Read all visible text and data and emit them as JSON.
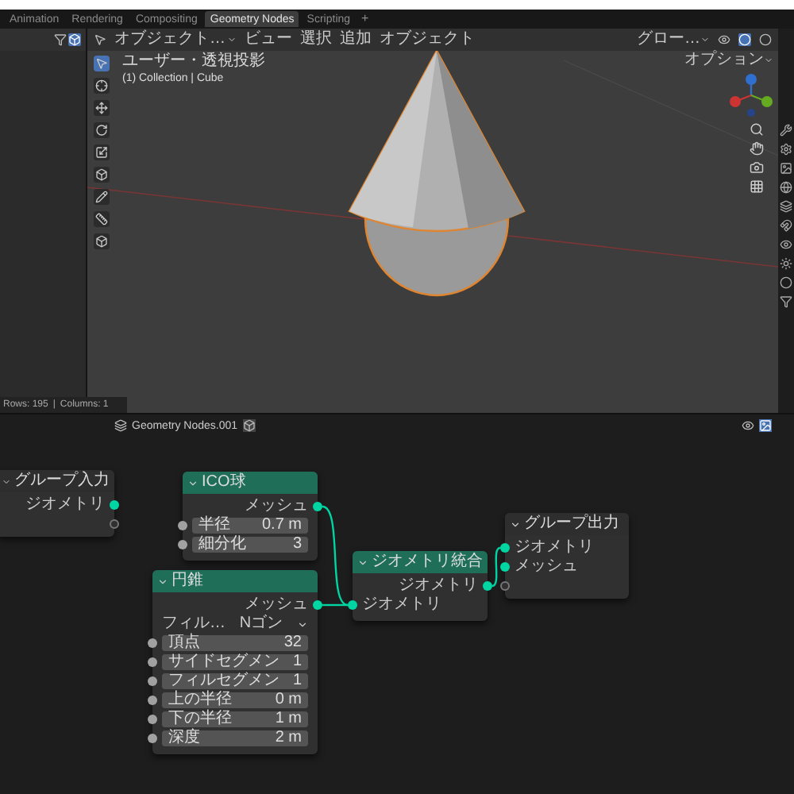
{
  "workspace_tabs": [
    {
      "label": "Animation",
      "selected": false
    },
    {
      "label": "Rendering",
      "selected": false
    },
    {
      "label": "Compositing",
      "selected": false
    },
    {
      "label": "Geometry Nodes",
      "selected": true
    },
    {
      "label": "Scripting",
      "selected": false
    }
  ],
  "add_tab": "+",
  "viewport": {
    "mode": "オブジェクト…",
    "menus": [
      "ビュー",
      "選択",
      "追加",
      "オブジェクト"
    ],
    "view_name": "ユーザー・透視投影",
    "collection": "(1) Collection | Cube",
    "orientation": "グロー…",
    "options": "オプション"
  },
  "spreadsheet_status": {
    "rows": "Rows: 195",
    "separator": "|",
    "columns": "Columns: 1"
  },
  "node_editor": {
    "tree_name": "Geometry Nodes.001",
    "nodes": [
      {
        "title": "グループ入力",
        "kind": "group",
        "outputs": [
          "ジオメトリ"
        ],
        "virtual_socket": true
      },
      {
        "title": "ICO球",
        "kind": "mesh",
        "outputs": [
          "メッシュ"
        ],
        "inputs": [
          {
            "label": "半径",
            "value": "0.7 m"
          },
          {
            "label": "細分化",
            "value": "3"
          }
        ],
        "virtual_socket": false
      },
      {
        "title": "円錐",
        "kind": "mesh",
        "outputs": [
          "メッシュ"
        ],
        "dropdown": {
          "label": "フィル…",
          "value": "Nゴン"
        },
        "inputs": [
          {
            "label": "頂点",
            "value": "32"
          },
          {
            "label": "サイドセグメン",
            "value": "1"
          },
          {
            "label": "フィルセグメン",
            "value": "1"
          },
          {
            "label": "上の半径",
            "value": "0 m"
          },
          {
            "label": "下の半径",
            "value": "1 m"
          },
          {
            "label": "深度",
            "value": "2 m"
          }
        ],
        "virtual_socket": false
      },
      {
        "title": "ジオメトリ統合",
        "kind": "geometry",
        "outputs": [
          "ジオメトリ"
        ],
        "inputs": [
          {
            "label": "ジオメトリ"
          }
        ],
        "virtual_socket": false
      },
      {
        "title": "グループ出力",
        "kind": "group",
        "inputs": [
          {
            "label": "ジオメトリ"
          },
          {
            "label": "メッシュ"
          }
        ],
        "virtual_socket": true
      }
    ]
  }
}
